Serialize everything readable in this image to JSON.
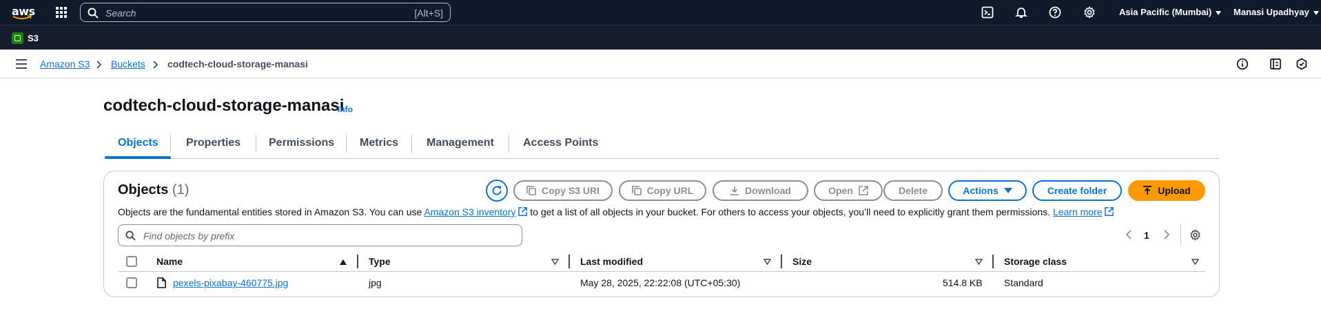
{
  "topnav": {
    "logo_text": "aws",
    "search_placeholder": "Search",
    "search_shortcut": "[Alt+S]",
    "region": "Asia Pacific (Mumbai)",
    "user": "Manasi Upadhyay"
  },
  "service": {
    "label": "S3"
  },
  "breadcrumb": {
    "items": [
      "Amazon S3",
      "Buckets"
    ],
    "current": "codtech-cloud-storage-manasi"
  },
  "page": {
    "title": "codtech-cloud-storage-manasi",
    "info": "Info"
  },
  "tabs": [
    "Objects",
    "Properties",
    "Permissions",
    "Metrics",
    "Management",
    "Access Points"
  ],
  "objects": {
    "heading": "Objects",
    "count": "(1)",
    "buttons": {
      "copy_s3_uri": "Copy S3 URI",
      "copy_url": "Copy URL",
      "download": "Download",
      "open": "Open",
      "delete": "Delete",
      "actions": "Actions",
      "create_folder": "Create folder",
      "upload": "Upload"
    },
    "desc_1": "Objects are the fundamental entities stored in Amazon S3. You can use",
    "desc_link_1": "Amazon S3 inventory",
    "desc_2": "to get a list of all objects in your bucket. For others to access your objects, you’ll need to explicitly grant them permissions.",
    "desc_link_2": "Learn more",
    "filter_placeholder": "Find objects by prefix",
    "page_number": "1",
    "columns": [
      "Name",
      "Type",
      "Last modified",
      "Size",
      "Storage class"
    ],
    "rows": [
      {
        "name": "pexels-pixabay-460775.jpg",
        "type": "jpg",
        "last_modified": "May 28, 2025, 22:22:08 (UTC+05:30)",
        "size": "514.8 KB",
        "storage_class": "Standard"
      }
    ]
  },
  "colors": {
    "nav_bg": "#0f1b2a",
    "link": "#0972d3",
    "upload": "#ff9900"
  }
}
